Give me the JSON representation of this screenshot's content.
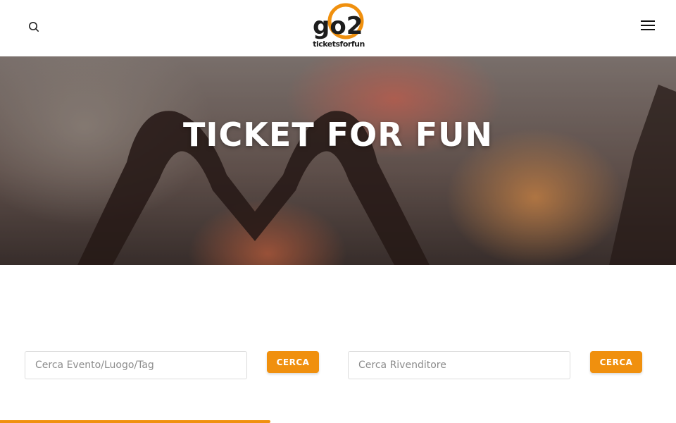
{
  "header": {
    "search_icon": "search-icon",
    "menu_icon": "hamburger-menu-icon",
    "logo": {
      "brand_mark": "go2",
      "tagline": "ticketsforfun",
      "accent_color": "#f0900e"
    }
  },
  "hero": {
    "title": "TICKET FOR FUN"
  },
  "search": {
    "event": {
      "placeholder": "Cerca Evento/Luogo/Tag",
      "value": "",
      "button_label": "CERCA"
    },
    "reseller": {
      "placeholder": "Cerca Rivenditore",
      "value": "",
      "button_label": "CERCA"
    }
  },
  "colors": {
    "accent": "#f0900e",
    "text_dark": "#1d1d1d",
    "border": "#dcdcdc"
  }
}
